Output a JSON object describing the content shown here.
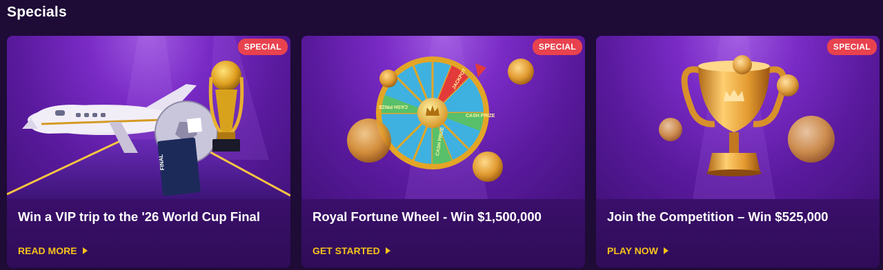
{
  "section": {
    "title": "Specials"
  },
  "cards": [
    {
      "badge": "SPECIAL",
      "title": "Win a VIP trip to the '26 World Cup Final",
      "cta": "READ MORE",
      "ticket_text": "FINAL",
      "image": "private-jet-trophy-icon"
    },
    {
      "badge": "SPECIAL",
      "title": "Royal Fortune Wheel - Win $1,500,000",
      "cta": "GET STARTED",
      "wheel_labels": [
        "JACKPOT",
        "CASH PRIZE",
        "CASH PRIZE",
        "CASH PRIZE"
      ],
      "image": "fortune-wheel-icon"
    },
    {
      "badge": "SPECIAL",
      "title": "Join the Competition – Win $525,000",
      "cta": "PLAY NOW",
      "image": "gold-trophy-icon"
    }
  ],
  "colors": {
    "accent": "#f7c21a",
    "badge": "#e8424e",
    "background": "#1e0b36",
    "card": "#3a1168"
  }
}
